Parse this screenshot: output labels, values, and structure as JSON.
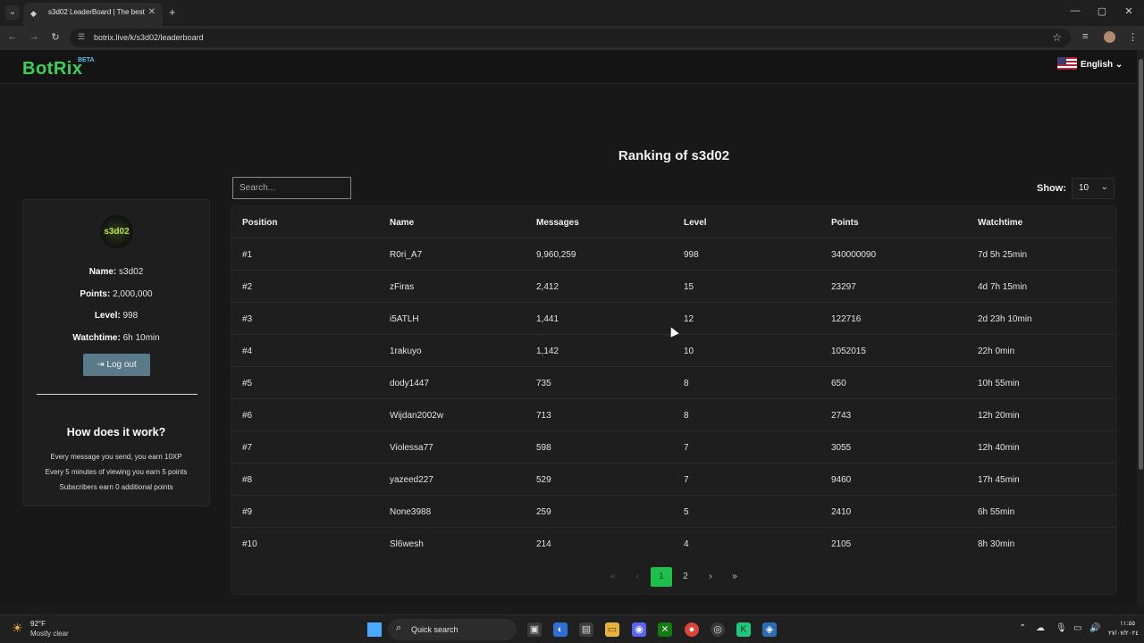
{
  "browser": {
    "tab_title": "s3d02 LeaderBoard | The best C",
    "tab_close": "✕",
    "new_tab": "+",
    "url": "botrix.live/k/s3d02/leaderboard"
  },
  "header": {
    "logo": "BotRix",
    "logo_badge": "BETA",
    "language": "English",
    "language_chevron": "⌄"
  },
  "sidebar": {
    "avatar_text": "s3d02",
    "name_label": "Name:",
    "name_value": "s3d02",
    "points_label": "Points:",
    "points_value": "2,000,000",
    "level_label": "Level:",
    "level_value": "998",
    "watchtime_label": "Watchtime:",
    "watchtime_value": "6h 10min",
    "logout_label": "Log out",
    "how_title": "How does it work?",
    "how_lines": [
      "Every message you send, you earn 10XP",
      "Every 5 minutes of viewing you earn 5 points",
      "Subscribers earn 0 additional points"
    ]
  },
  "main": {
    "title": "Ranking of s3d02",
    "search_placeholder": "Search...",
    "show_label": "Show:",
    "show_value": "10",
    "columns": [
      "Position",
      "Name",
      "Messages",
      "Level",
      "Points",
      "Watchtime"
    ],
    "rows": [
      [
        "#1",
        "R0ri_A7",
        "9,960,259",
        "998",
        "340000090",
        "7d 5h 25min"
      ],
      [
        "#2",
        "zFiras",
        "2,412",
        "15",
        "23297",
        "4d 7h 15min"
      ],
      [
        "#3",
        "i5ATLH",
        "1,441",
        "12",
        "122716",
        "2d 23h 10min"
      ],
      [
        "#4",
        "1rakuyo",
        "1,142",
        "10",
        "1052015",
        "22h 0min"
      ],
      [
        "#5",
        "dody1447",
        "735",
        "8",
        "650",
        "10h 55min"
      ],
      [
        "#6",
        "Wijdan2002w",
        "713",
        "8",
        "2743",
        "12h 20min"
      ],
      [
        "#7",
        "Violessa77",
        "598",
        "7",
        "3055",
        "12h 40min"
      ],
      [
        "#8",
        "yazeed227",
        "529",
        "7",
        "9460",
        "17h 45min"
      ],
      [
        "#9",
        "None3988",
        "259",
        "5",
        "2410",
        "6h 55min"
      ],
      [
        "#10",
        "Sl6wesh",
        "214",
        "4",
        "2105",
        "8h 30min"
      ]
    ],
    "pagination": {
      "first": "«",
      "prev": "‹",
      "pages": [
        "1",
        "2"
      ],
      "active_page": "1",
      "next": "›",
      "last": "»"
    }
  },
  "taskbar": {
    "temperature": "92°F",
    "weather": "Mostly clear",
    "search_label": "Quick search",
    "time": "١١:٥٥",
    "date": "٢٧/٠٧/٢٠٢٤"
  },
  "colors": {
    "brand_green": "#3ad25a",
    "active_page": "#1fbf4b",
    "logout_button": "#5b7a89",
    "background": "#181818"
  }
}
